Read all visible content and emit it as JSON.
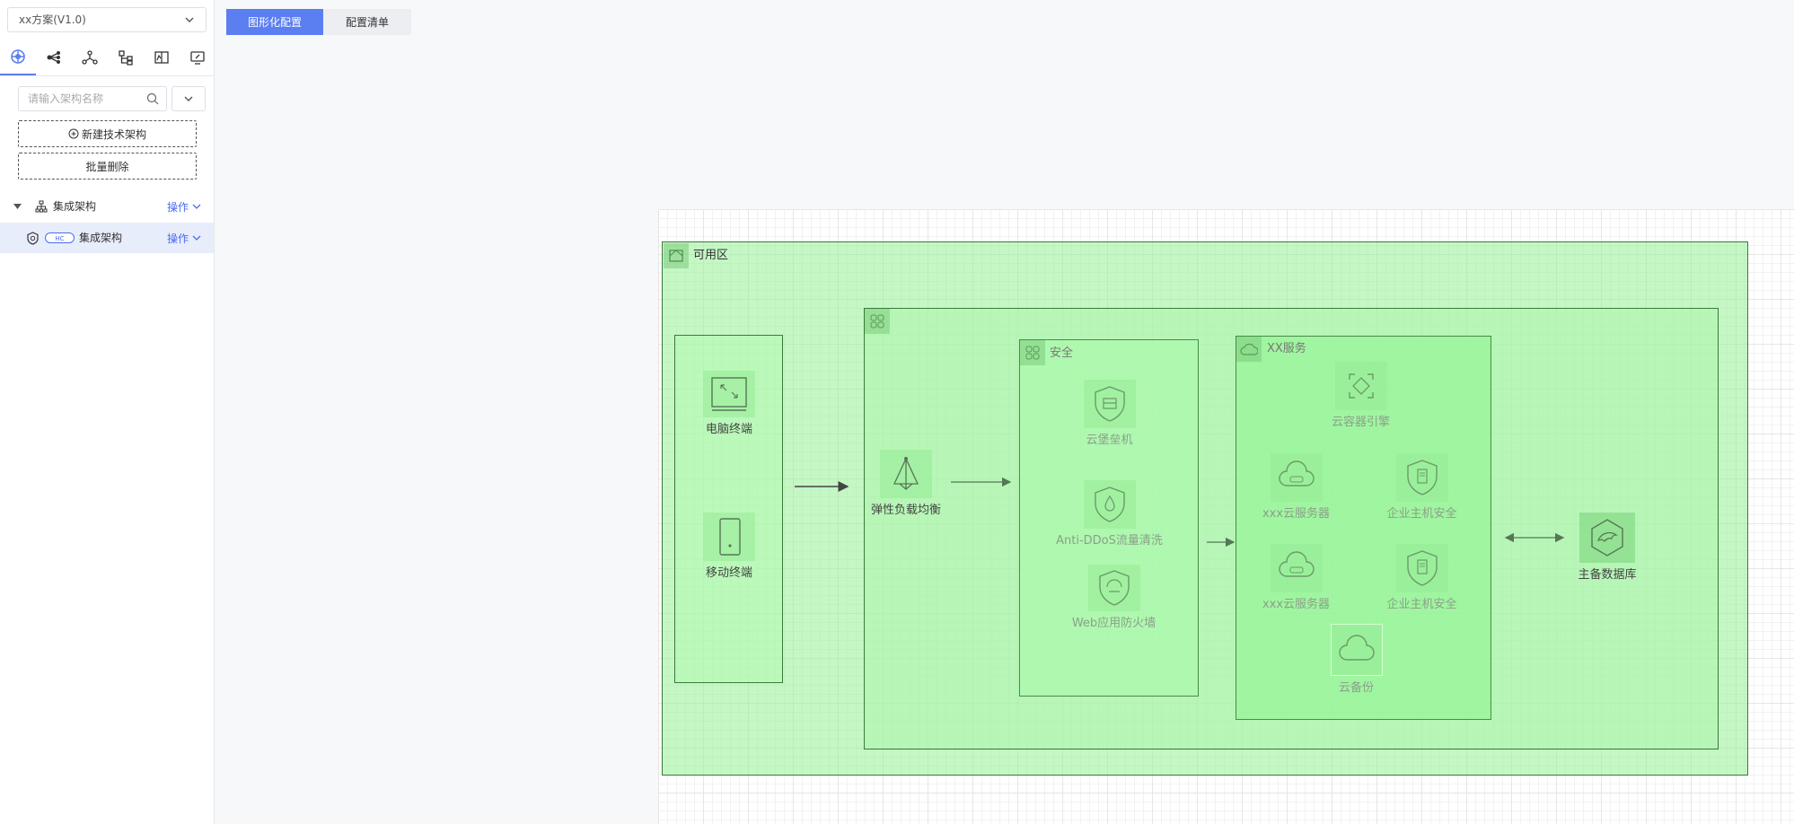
{
  "sidebar": {
    "scheme_select": "xx方案(V1.0)",
    "icon_tabs": [
      "architecture-tab-icon",
      "flow-tab-icon",
      "topology-tab-icon",
      "hierarchy-tab-icon",
      "report-tab-icon",
      "monitor-tab-icon"
    ],
    "search_placeholder": "请输入架构名称",
    "new_button": "新建技术架构",
    "batch_delete_button": "批量删除",
    "tree": [
      {
        "label": "集成架构",
        "op": "操作"
      },
      {
        "label": "集成架构",
        "badge": "HC",
        "op": "操作"
      }
    ]
  },
  "top_tabs": [
    "图形化配置",
    "配置清单"
  ],
  "canvas": {
    "zone_label": "可用区",
    "client_nodes": [
      "电脑终端",
      "移动终端"
    ],
    "lb_node": "弹性负载均衡",
    "security_group": {
      "label": "安全",
      "nodes": [
        "云堡垒机",
        "Anti-DDoS流量清洗",
        "Web应用防火墙"
      ]
    },
    "service_group": {
      "label": "XX服务",
      "nodes": [
        "云容器引擎",
        "xxx云服务器",
        "企业主机安全",
        "xxx云服务器",
        "企业主机安全",
        "云备份"
      ]
    },
    "db_node": "主备数据库"
  },
  "colors": {
    "accent": "#5b7ef0",
    "zone_fill": "#c2f5c2",
    "zone_border": "#3a7a3a"
  }
}
